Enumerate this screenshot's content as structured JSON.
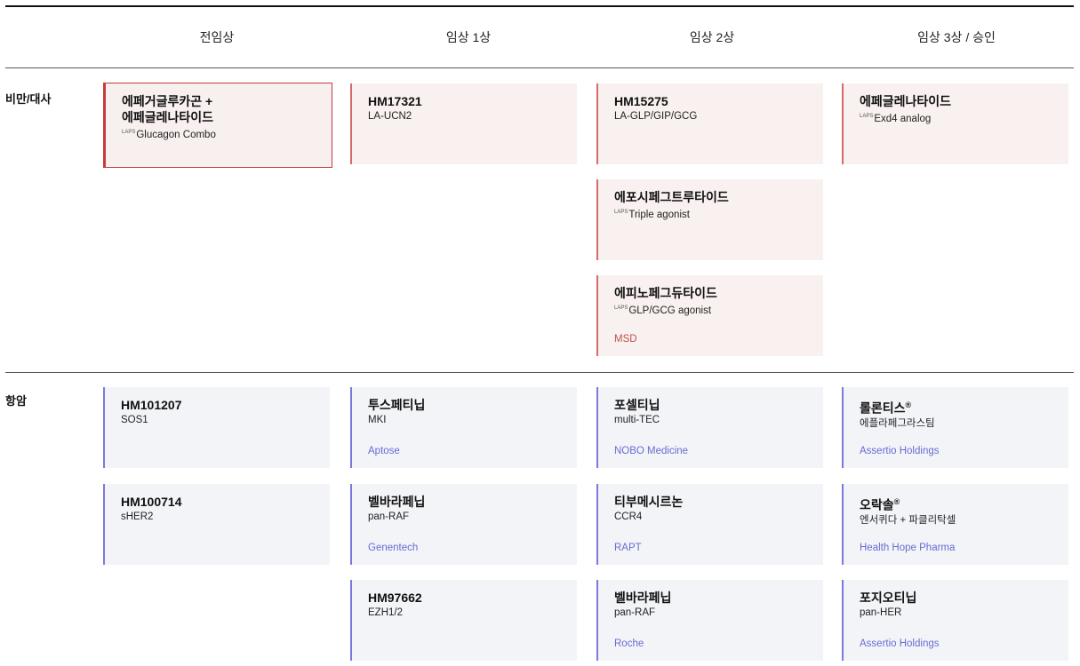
{
  "stages": [
    "전임상",
    "임상 1상",
    "임상 2상",
    "임상 3상 / 승인"
  ],
  "categories": {
    "metabolic": "비만/대사",
    "oncology": "항암"
  },
  "cards": {
    "m1": {
      "name_line1": "에페거글루카곤 +",
      "name_line2": "에페글레나타이드",
      "sup": "LAPS",
      "desc": "Glucagon Combo"
    },
    "m2": {
      "name": "HM17321",
      "desc": "LA-UCN2"
    },
    "m3": {
      "name": "HM15275",
      "desc": "LA-GLP/GIP/GCG"
    },
    "m4": {
      "name": "에페글레나타이드",
      "sup": "LAPS",
      "desc": "Exd4 analog"
    },
    "m5": {
      "name": "에포시페그트루타이드",
      "sup": "LAPS",
      "desc": "Triple agonist"
    },
    "m6": {
      "name": "에피노페그듀타이드",
      "sup": "LAPS",
      "desc": "GLP/GCG agonist",
      "partner": "MSD"
    },
    "o1": {
      "name": "HM101207",
      "desc": "SOS1"
    },
    "o2": {
      "name": "투스페티닙",
      "desc": "MKI",
      "partner": "Aptose"
    },
    "o3": {
      "name": "포셀티닙",
      "desc": "multi-TEC",
      "partner": "NOBO Medicine"
    },
    "o4": {
      "name": "롤론티스",
      "reg": "®",
      "desc": "에플라페그라스팀",
      "partner": "Assertio Holdings"
    },
    "o5": {
      "name": "HM100714",
      "desc": "sHER2"
    },
    "o6": {
      "name": "벨바라페닙",
      "desc": "pan-RAF",
      "partner": "Genentech"
    },
    "o7": {
      "name": "티부메시르논",
      "desc": "CCR4",
      "partner": "RAPT"
    },
    "o8": {
      "name": "오락솔",
      "reg": "®",
      "desc": "엔서퀴다 + 파클리탁셀",
      "partner": "Health Hope Pharma"
    },
    "o9": {
      "name": "HM97662",
      "desc": "EZH1/2"
    },
    "o10": {
      "name": "벨바라페닙",
      "desc": "pan-RAF",
      "partner": "Roche"
    },
    "o11": {
      "name": "포지오티닙",
      "desc": "pan-HER",
      "partner": "Assertio Holdings"
    }
  }
}
